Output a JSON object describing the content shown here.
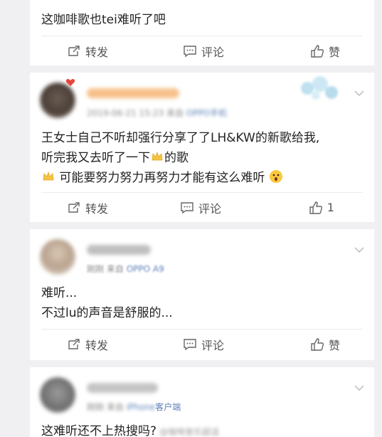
{
  "actions": {
    "repost_label": "转发",
    "comment_label": "评论",
    "like_label": "赞"
  },
  "posts": [
    {
      "text": "这咖啡歌也tei难听了吧",
      "like_count": ""
    },
    {
      "device": "OPPO手机",
      "text_line1": "王女士自己不听却强行分享了了LH&KW的新歌给我,",
      "text_line2a": "听完我又去听了一下",
      "text_line2b": "的歌",
      "text_line3": "可能要努力努力再努力才能有这么难听",
      "like_count": "1"
    },
    {
      "time": "刚刚",
      "source_prefix": "来自",
      "device": "OPPO A9",
      "text_line1": "难听...",
      "text_line2": "不过lu的声音是舒服的...",
      "like_count": ""
    },
    {
      "time": "刚刚",
      "source_prefix": "来自",
      "device_blur": "iPhone",
      "device_suffix": "客户端",
      "text_line1": "这难听还不上热搜吗?",
      "watermark": "@咖啡音乐超话"
    }
  ]
}
